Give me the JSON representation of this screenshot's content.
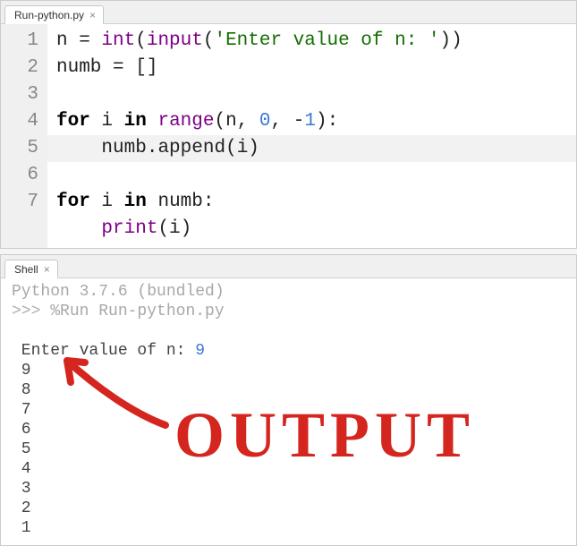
{
  "editor": {
    "tab_label": "Run-python.py",
    "lines": [
      {
        "num": "1",
        "tokens": [
          {
            "t": "id",
            "v": "n"
          },
          {
            "t": "op",
            "v": " = "
          },
          {
            "t": "func",
            "v": "int"
          },
          {
            "t": "op",
            "v": "("
          },
          {
            "t": "func",
            "v": "input"
          },
          {
            "t": "op",
            "v": "("
          },
          {
            "t": "str",
            "v": "'Enter value of n: '"
          },
          {
            "t": "op",
            "v": "))"
          }
        ],
        "hl": false
      },
      {
        "num": "2",
        "tokens": [
          {
            "t": "id",
            "v": "numb"
          },
          {
            "t": "op",
            "v": " = []"
          }
        ],
        "hl": false
      },
      {
        "num": "3",
        "tokens": [],
        "hl": false
      },
      {
        "num": "4",
        "tokens": [
          {
            "t": "kw",
            "v": "for"
          },
          {
            "t": "op",
            "v": " "
          },
          {
            "t": "id",
            "v": "i"
          },
          {
            "t": "op",
            "v": " "
          },
          {
            "t": "kw",
            "v": "in"
          },
          {
            "t": "op",
            "v": " "
          },
          {
            "t": "func",
            "v": "range"
          },
          {
            "t": "op",
            "v": "("
          },
          {
            "t": "id",
            "v": "n"
          },
          {
            "t": "op",
            "v": ", "
          },
          {
            "t": "num",
            "v": "0"
          },
          {
            "t": "op",
            "v": ", "
          },
          {
            "t": "op",
            "v": "-"
          },
          {
            "t": "num",
            "v": "1"
          },
          {
            "t": "op",
            "v": "):"
          }
        ],
        "hl": false
      },
      {
        "num": "5",
        "tokens": [
          {
            "t": "op",
            "v": "    "
          },
          {
            "t": "id",
            "v": "numb"
          },
          {
            "t": "op",
            "v": "."
          },
          {
            "t": "id",
            "v": "append"
          },
          {
            "t": "op",
            "v": "("
          },
          {
            "t": "id",
            "v": "i"
          },
          {
            "t": "op",
            "v": ")"
          }
        ],
        "hl": true
      },
      {
        "num": "6",
        "tokens": [
          {
            "t": "kw",
            "v": "for"
          },
          {
            "t": "op",
            "v": " "
          },
          {
            "t": "id",
            "v": "i"
          },
          {
            "t": "op",
            "v": " "
          },
          {
            "t": "kw",
            "v": "in"
          },
          {
            "t": "op",
            "v": " "
          },
          {
            "t": "id",
            "v": "numb"
          },
          {
            "t": "op",
            "v": ":"
          }
        ],
        "hl": false
      },
      {
        "num": "7",
        "tokens": [
          {
            "t": "op",
            "v": "    "
          },
          {
            "t": "func",
            "v": "print"
          },
          {
            "t": "op",
            "v": "("
          },
          {
            "t": "id",
            "v": "i"
          },
          {
            "t": "op",
            "v": ")"
          }
        ],
        "hl": false
      }
    ]
  },
  "shell": {
    "tab_label": "Shell",
    "version_line": "Python 3.7.6 (bundled)",
    "prompt": ">>> ",
    "run_cmd": "%Run Run-python.py",
    "input_prompt": " Enter value of n: ",
    "input_value": "9",
    "output_lines": [
      " 9",
      " 8",
      " 7",
      " 6",
      " 5",
      " 4",
      " 3",
      " 2",
      " 1"
    ]
  },
  "annotation": {
    "text": "OUTPUT",
    "color": "#d4261f"
  }
}
